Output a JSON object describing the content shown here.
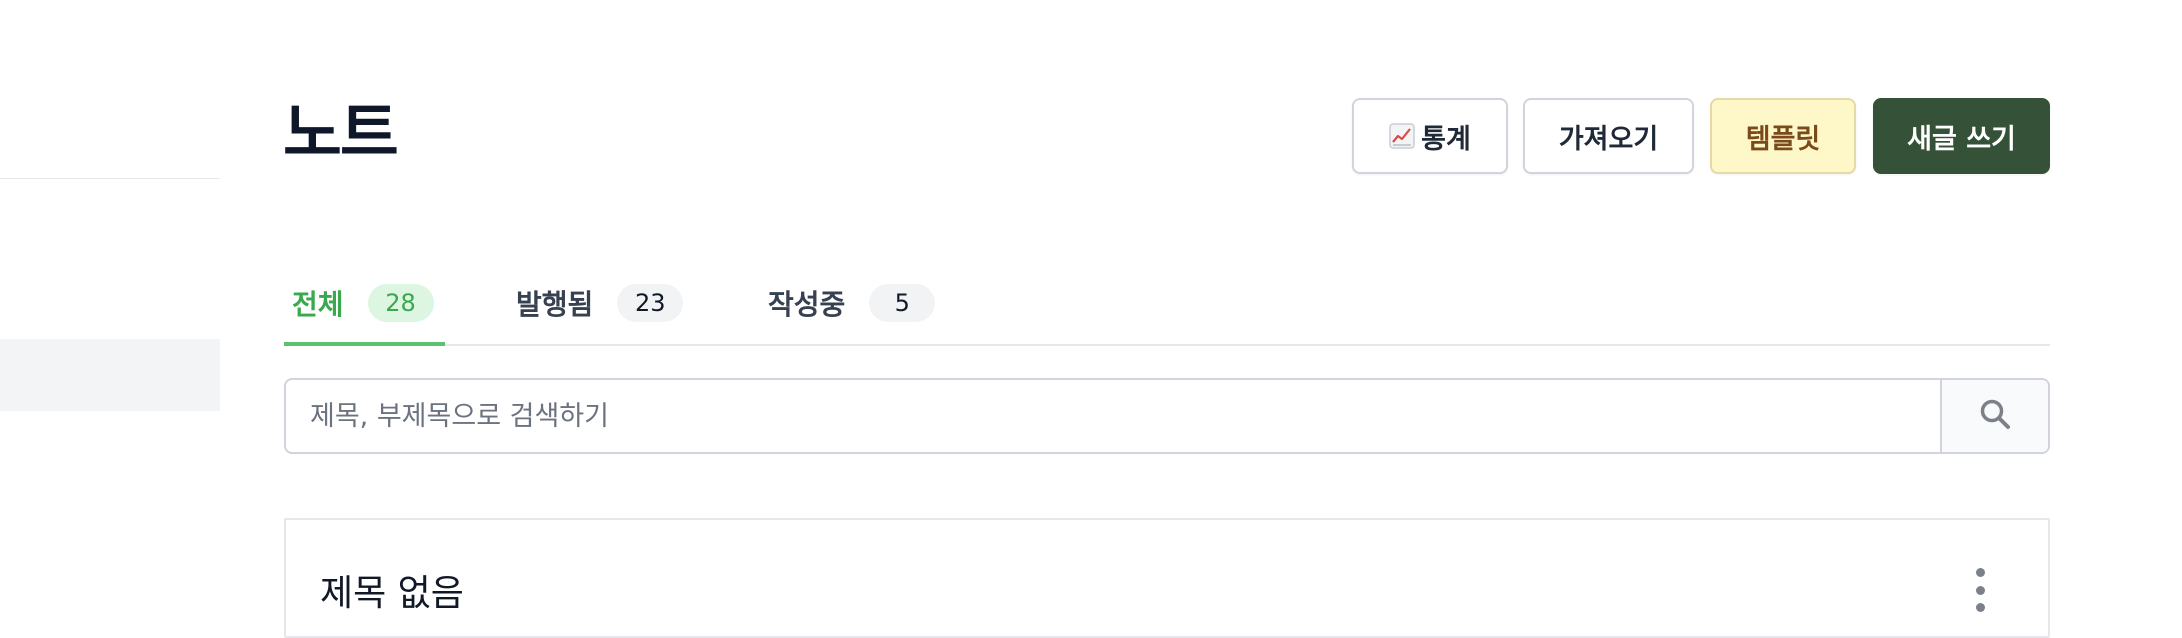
{
  "page": {
    "title": "노트"
  },
  "toolbar": {
    "stats_label": "통계",
    "import_label": "가져오기",
    "template_label": "템플릿",
    "new_post_label": "새글 쓰기"
  },
  "tabs": [
    {
      "label": "전체",
      "count": "28",
      "active": true
    },
    {
      "label": "발행됨",
      "count": "23",
      "active": false
    },
    {
      "label": "작성중",
      "count": "5",
      "active": false
    }
  ],
  "search": {
    "placeholder": "제목, 부제목으로 검색하기",
    "value": ""
  },
  "notes": [
    {
      "title": "제목 없음"
    }
  ],
  "icons": {
    "stats": "chart-increasing-icon",
    "search": "search-icon",
    "menu": "more-vertical-icon"
  },
  "colors": {
    "accent_green": "#3aa84f",
    "primary_button": "#355238",
    "template_button": "#fef8c9"
  }
}
